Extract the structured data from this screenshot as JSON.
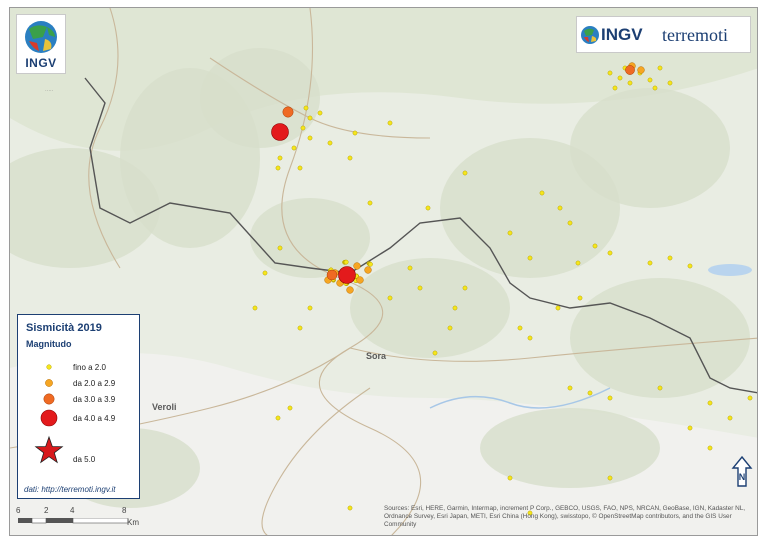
{
  "logo": {
    "text": "INGV"
  },
  "brand": {
    "strong": "INGV",
    "light": "terremoti"
  },
  "legend": {
    "title": "Sismicità 2019",
    "subtitle": "Magnitudo",
    "classes": [
      {
        "label": "fino a 2.0",
        "color": "#f5e61c"
      },
      {
        "label": "da 2.0 a 2.9",
        "color": "#f6a623"
      },
      {
        "label": "da 3.0 a 3.9",
        "color": "#ef6a23"
      },
      {
        "label": "da 4.0 a 4.9",
        "color": "#e31a1c"
      },
      {
        "label": "da 5.0",
        "color": "#d7191c"
      }
    ],
    "source": "dati: http://terremoti.ingv.it"
  },
  "scale": {
    "ticks": [
      "6",
      "2",
      "4",
      "8"
    ],
    "unit": "Km"
  },
  "towns": {
    "sora": "Sora",
    "veroli": "Veroli"
  },
  "attribution": "Sources: Esri, HERE, Garmin, Intermap, increment P Corp., GEBCO, USGS, FAO, NPS, NRCAN, GeoBase, IGN, Kadaster NL, Ordnance Survey, Esri Japan, METI, Esri China (Hong Kong), swisstopo, © OpenStreetMap contributors, and the GIS User Community",
  "north": {
    "label": "N"
  }
}
